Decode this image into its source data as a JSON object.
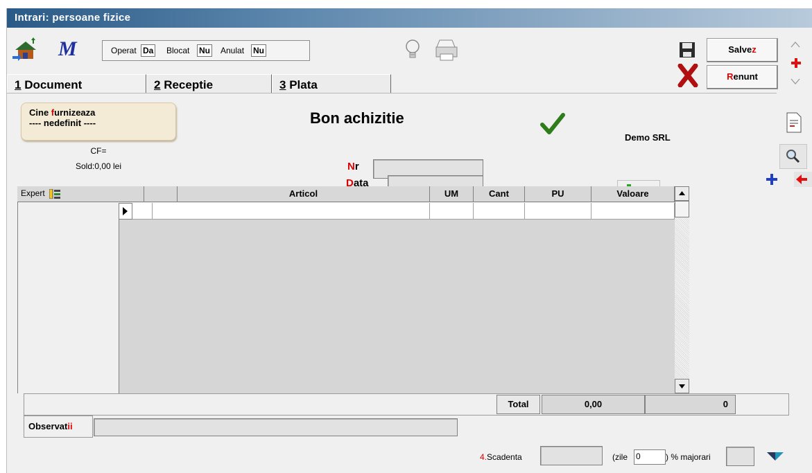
{
  "window": {
    "title": "Intrari: persoane fizice"
  },
  "toolbar": {
    "operat_label": "Operat",
    "operat_value": "Da",
    "blocat_label": "Blocat",
    "blocat_value": "Nu",
    "anulat_label": "Anulat",
    "anulat_value": "Nu",
    "save_prefix": "Salve",
    "save_accent": "z",
    "cancel_accent": "R",
    "cancel_rest": "enunt"
  },
  "tabs": [
    {
      "num": "1",
      "label": " Document"
    },
    {
      "num": "2",
      "label": " Receptie"
    },
    {
      "num": "3",
      "label": " Plata"
    }
  ],
  "supplier": {
    "line1_a": "Cine ",
    "line1_accent": "f",
    "line1_b": "urnizeaza",
    "line2": "---- nedefinit ----",
    "cf": "CF=",
    "sold": "Sold:0,00 lei"
  },
  "document": {
    "title": "Bon achizitie",
    "company": "Demo SRL",
    "nr_accent": "N",
    "nr_rest": "r",
    "data_accent": "D",
    "data_rest": "ata",
    "nr_value": "",
    "data_value": ""
  },
  "grid": {
    "expert_label": "Expert",
    "columns": [
      "Articol",
      "UM",
      "Cant",
      "PU",
      "Valoare"
    ],
    "rows": [
      {
        "articol": "",
        "um": "",
        "cant": "",
        "pu": "",
        "valoare": ""
      }
    ],
    "total_label": "Total",
    "total_value": "0,00",
    "total_count": "0"
  },
  "observatii": {
    "label_a": "Observat",
    "label_accent": "ii",
    "value": ""
  },
  "footer": {
    "scadenta_num": "4.",
    "scadenta_label": "Scadenta",
    "zile_label": "(zile",
    "zile_value": "0",
    "majorari_label": ") % majorari"
  }
}
